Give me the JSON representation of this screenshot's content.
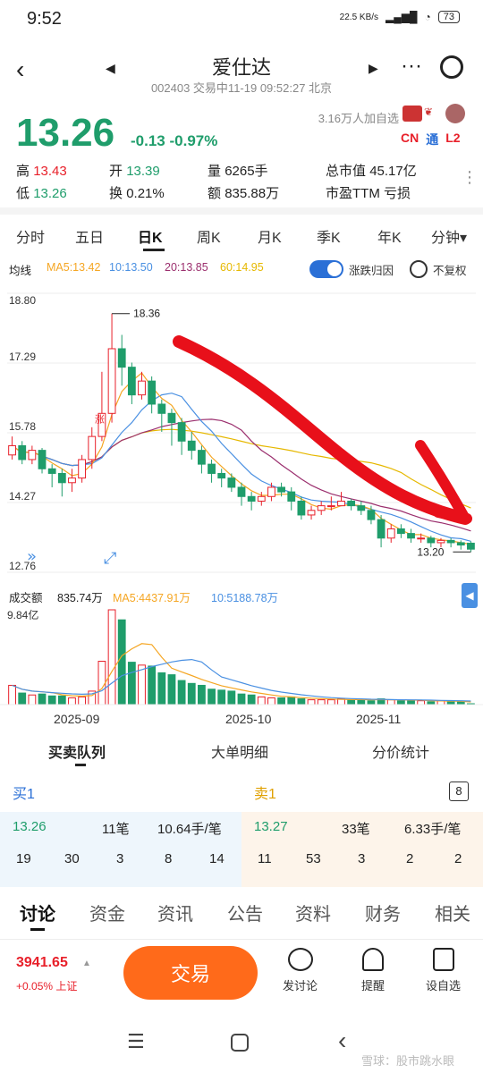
{
  "status": {
    "time": "9:52",
    "speed": "22.5 KB/s",
    "battery": "73"
  },
  "header": {
    "title": "爱仕达",
    "subtitle": "002403 交易中11-19 09:52:27 北京",
    "followers": "3.16万人加自选",
    "tags": [
      "CN",
      "通",
      "L2"
    ]
  },
  "quote": {
    "price": "13.26",
    "change": "-0.13",
    "change_pct": "-0.97%",
    "high_label": "高",
    "high": "13.43",
    "open_label": "开",
    "open": "13.39",
    "vol_label": "量",
    "vol": "6265手",
    "mcap_label": "总市值",
    "mcap": "45.17亿",
    "low_label": "低",
    "low": "13.26",
    "turnover_label": "换",
    "turnover": "0.21%",
    "amount_label": "额",
    "amount": "835.88万",
    "pe_label": "市盈TTM",
    "pe": "亏损"
  },
  "tabs": [
    "分时",
    "五日",
    "日K",
    "周K",
    "月K",
    "季K",
    "年K",
    "分钟▾"
  ],
  "ma": {
    "label": "均线",
    "ma5": "MA5:13.42",
    "ma10": "10:13.50",
    "ma20": "20:13.85",
    "ma60": "60:14.95",
    "toggle_label": "涨跌归因",
    "adjust_label": "不复权"
  },
  "chart": {
    "y_labels": [
      "18.80",
      "17.29",
      "15.78",
      "14.27",
      "12.76"
    ],
    "high_mark": "18.36",
    "low_mark": "13.20",
    "zhang": "涨",
    "colors": {
      "up": "#e8202a",
      "down": "#1f9d6b",
      "ma5": "#f5a623",
      "ma10": "#4a90e2",
      "ma20": "#9b2f6e",
      "ma60": "#e6b800"
    }
  },
  "chart_data": {
    "type": "candlestick",
    "y_range": [
      12.76,
      18.8
    ],
    "x_labels": [
      "2025-09",
      "2025-10",
      "2025-11"
    ],
    "candles": [
      [
        15.3,
        15.5,
        15.7,
        15.2
      ],
      [
        15.5,
        15.2,
        15.6,
        15.1
      ],
      [
        15.2,
        15.4,
        15.5,
        15.1
      ],
      [
        15.4,
        15.0,
        15.45,
        14.9
      ],
      [
        15.0,
        14.9,
        15.1,
        14.6
      ],
      [
        14.9,
        14.7,
        15.0,
        14.4
      ],
      [
        14.7,
        14.8,
        15.0,
        14.5
      ],
      [
        14.8,
        15.2,
        15.3,
        14.7
      ],
      [
        15.2,
        15.7,
        15.9,
        15.0
      ],
      [
        15.7,
        16.2,
        17.1,
        15.6
      ],
      [
        16.2,
        17.6,
        18.36,
        16.0
      ],
      [
        17.6,
        17.2,
        17.9,
        16.8
      ],
      [
        17.2,
        16.6,
        17.3,
        16.4
      ],
      [
        16.6,
        16.9,
        17.1,
        16.5
      ],
      [
        16.9,
        16.4,
        17.0,
        16.2
      ],
      [
        16.4,
        16.2,
        16.5,
        15.8
      ],
      [
        16.2,
        16.0,
        16.3,
        15.5
      ],
      [
        16.0,
        15.6,
        16.1,
        15.3
      ],
      [
        15.6,
        15.4,
        15.8,
        15.2
      ],
      [
        15.4,
        15.1,
        15.5,
        14.9
      ],
      [
        15.1,
        14.9,
        15.2,
        14.7
      ],
      [
        14.9,
        14.8,
        15.0,
        14.6
      ],
      [
        14.8,
        14.6,
        14.9,
        14.5
      ],
      [
        14.6,
        14.4,
        14.7,
        14.2
      ],
      [
        14.4,
        14.3,
        14.5,
        14.1
      ],
      [
        14.3,
        14.4,
        14.5,
        14.2
      ],
      [
        14.4,
        14.6,
        14.7,
        14.3
      ],
      [
        14.6,
        14.5,
        14.7,
        14.4
      ],
      [
        14.5,
        14.3,
        14.6,
        14.1
      ],
      [
        14.3,
        14.0,
        14.4,
        13.9
      ],
      [
        14.0,
        14.1,
        14.2,
        13.9
      ],
      [
        14.1,
        14.2,
        14.3,
        14.0
      ],
      [
        14.2,
        14.2,
        14.4,
        14.1
      ],
      [
        14.2,
        14.3,
        14.5,
        14.2
      ],
      [
        14.3,
        14.2,
        14.35,
        14.1
      ],
      [
        14.2,
        14.1,
        14.3,
        14.0
      ],
      [
        14.1,
        13.9,
        14.2,
        13.8
      ],
      [
        13.9,
        13.5,
        14.0,
        13.3
      ],
      [
        13.5,
        13.7,
        13.8,
        13.4
      ],
      [
        13.7,
        13.6,
        13.8,
        13.5
      ],
      [
        13.6,
        13.5,
        13.7,
        13.4
      ],
      [
        13.5,
        13.5,
        13.6,
        13.4
      ],
      [
        13.5,
        13.4,
        13.55,
        13.3
      ],
      [
        13.4,
        13.45,
        13.5,
        13.3
      ],
      [
        13.45,
        13.4,
        13.5,
        13.3
      ],
      [
        13.4,
        13.35,
        13.45,
        13.25
      ],
      [
        13.39,
        13.26,
        13.43,
        13.2
      ]
    ],
    "volumes": [
      2.0,
      1.2,
      1.0,
      1.1,
      0.9,
      0.9,
      0.7,
      0.8,
      1.4,
      4.5,
      9.84,
      8.8,
      4.4,
      4.1,
      4.0,
      3.3,
      3.1,
      2.5,
      2.2,
      2.0,
      1.6,
      1.5,
      1.4,
      1.1,
      1.0,
      0.8,
      0.7,
      0.7,
      0.8,
      0.6,
      0.5,
      0.5,
      0.5,
      0.6,
      0.5,
      0.5,
      0.4,
      0.6,
      0.5,
      0.4,
      0.4,
      0.4,
      0.3,
      0.4,
      0.3,
      0.3,
      0.09
    ]
  },
  "volume": {
    "label": "成交额",
    "value": "835.74万",
    "ma5": "MA5:4437.91万",
    "ma10": "10:5188.78万",
    "max": "9.84亿"
  },
  "sections": [
    "买卖队列",
    "大单明细",
    "分价统计"
  ],
  "queue": {
    "buy_label": "买1",
    "sell_label": "卖1",
    "count_box": "8",
    "buy": {
      "price": "13.26",
      "orders": "11笔",
      "avg": "10.64手/笔",
      "nums": [
        "19",
        "30",
        "3",
        "8",
        "14"
      ]
    },
    "sell": {
      "price": "13.27",
      "orders": "33笔",
      "avg": "6.33手/笔",
      "nums": [
        "11",
        "53",
        "3",
        "2",
        "2"
      ]
    }
  },
  "bottom_nav": [
    "讨论",
    "资金",
    "资讯",
    "公告",
    "资料",
    "财务",
    "相关"
  ],
  "index": {
    "value": "3941.65",
    "change": "+0.05% 上证"
  },
  "trade_label": "交易",
  "tools": [
    "发讨论",
    "提醒",
    "设自选"
  ],
  "watermark": "雪球：股市跳水眼"
}
